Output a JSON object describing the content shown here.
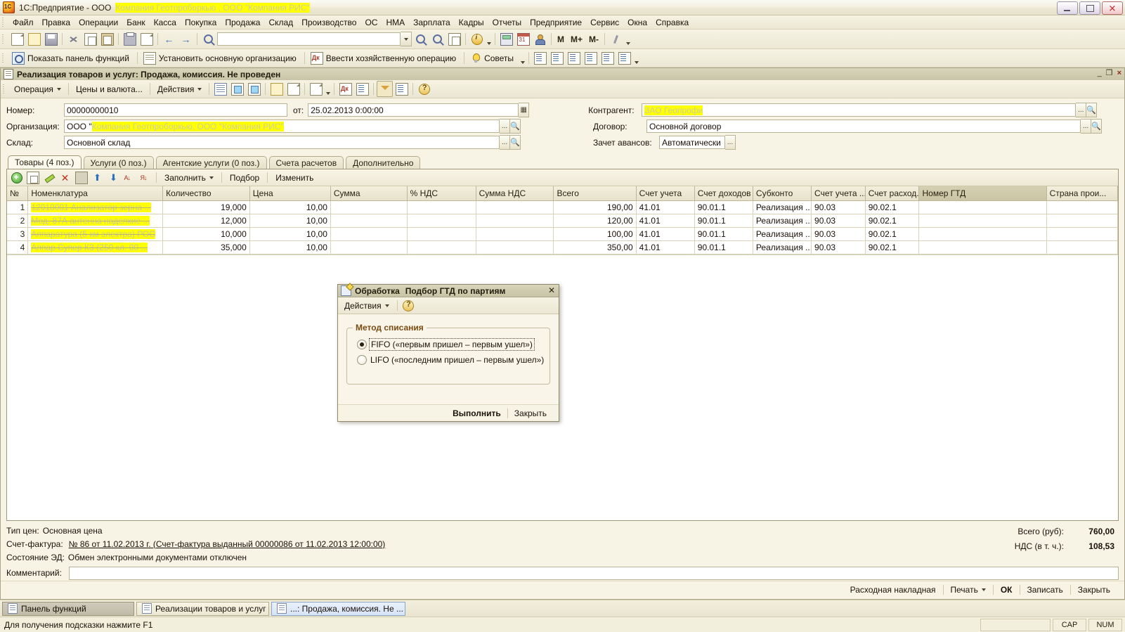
{
  "window": {
    "title_prefix": "1С:Предприятие - ООО",
    "title_redacted": "Компания Геотпроборкью , ООО \"Компания РИС\"",
    "minimize": "_",
    "restore": "❐",
    "close": "×"
  },
  "menubar": {
    "items": [
      "Файл",
      "Правка",
      "Операции",
      "Банк",
      "Касса",
      "Покупка",
      "Продажа",
      "Склад",
      "Производство",
      "ОС",
      "НМА",
      "Зарплата",
      "Кадры",
      "Отчеты",
      "Предприятие",
      "Сервис",
      "Окна",
      "Справка"
    ]
  },
  "toolbar_main": {
    "icons": [
      "new-document-icon",
      "open-document-icon",
      "save-icon",
      "cut-icon",
      "copy-icon",
      "paste-icon",
      "print-icon",
      "print-preview-icon",
      "undo-icon",
      "redo-icon",
      "find-icon"
    ],
    "search_value": "",
    "search_placeholder": "",
    "icons2": [
      "find-next-icon",
      "find-prev-icon",
      "copy-window-icon",
      "info-icon",
      "calculator-icon",
      "calendar-icon",
      "user-icon"
    ],
    "m_buttons": [
      "M",
      "M+",
      "M-"
    ],
    "settings_icon": "wrench-icon"
  },
  "toolbar_secondary": {
    "buttons": [
      {
        "label": "Показать панель функций",
        "icon": "functions-panel-icon"
      },
      {
        "label": "Установить основную организацию",
        "icon": "organization-icon"
      },
      {
        "label": "Ввести хозяйственную операцию",
        "icon": "dk-operation-icon"
      },
      {
        "label": "Советы",
        "icon": "lightbulb-icon"
      }
    ],
    "report_icons": [
      "report-turnover-icon",
      "report-balance-icon",
      "report-analysis-icon",
      "report-card-icon",
      "report-journal-icon",
      "report-chart-icon"
    ]
  },
  "document": {
    "title": "Реализация товаров и услуг: Продажа, комиссия. Не проведен",
    "win_minimize": "_",
    "win_restore": "❐",
    "win_close": "×",
    "toolbar": {
      "operation": "Операция",
      "prices": "Цены и валюта...",
      "actions": "Действия",
      "icons": [
        "post-and-close-icon",
        "post-icon",
        "post-new-icon",
        "fill-document-icon",
        "clear-icon",
        "based-on-icon",
        "dt-kt-icon",
        "register-report-icon",
        "filter-icon",
        "settings-list-icon",
        "help-icon"
      ]
    },
    "fields": {
      "number_label": "Номер:",
      "number_value": "00000000010",
      "date_label": "от:",
      "date_value": "25.02.2013  0:00:00",
      "organization_label": "Организация:",
      "organization_prefix": "ООО \"",
      "organization_redacted": "Компания Геотпроборкью, ООО \"Компания РИС\"",
      "warehouse_label": "Склад:",
      "warehouse_value": "Основной склад",
      "counterparty_label": "Контрагент:",
      "counterparty_redacted": "ЗАО Геопрофи",
      "contract_label": "Договор:",
      "contract_value": "Основной договор",
      "advances_label": "Зачет авансов:",
      "advances_value": "Автоматически"
    },
    "tabs": [
      {
        "label": "Товары (4 поз.)",
        "active": true
      },
      {
        "label": "Услуги (0 поз.)",
        "active": false
      },
      {
        "label": "Агентские услуги (0 поз.)",
        "active": false
      },
      {
        "label": "Счета расчетов",
        "active": false
      },
      {
        "label": "Дополнительно",
        "active": false
      }
    ],
    "grid_toolbar": {
      "icons": [
        "add-row-icon",
        "copy-row-icon",
        "edit-row-icon",
        "delete-row-icon",
        "set-period-icon",
        "move-up-icon",
        "move-down-icon",
        "sort-asc-icon",
        "sort-desc-icon"
      ],
      "fill": "Заполнить",
      "select": "Подбор",
      "change": "Изменить"
    },
    "table": {
      "columns": [
        "№",
        "Номенклатура",
        "Количество",
        "Цена",
        "Сумма",
        "% НДС",
        "Сумма НДС",
        "Всего",
        "Счет учета",
        "Счет доходов",
        "Субконто",
        "Счет учета ...",
        "Счет расход...",
        "Номер ГТД",
        "Страна прои..."
      ],
      "selected_column": "Номер ГТД",
      "rows": [
        {
          "n": "1",
          "nomenclature": "12010001 Анализатор зерна ...",
          "qty": "19,000",
          "price": "10,00",
          "sum": "",
          "vat_pct": "",
          "vat_sum": "",
          "total": "190,00",
          "acc": "41.01",
          "income_acc": "90.01.1",
          "subconto": "Реализация ...",
          "vat_acc": "90.03",
          "expense_acc": "90.02.1",
          "gtd": "",
          "country": ""
        },
        {
          "n": "2",
          "nomenclature": "Мод. 87А антенна наделкие ...",
          "qty": "12,000",
          "price": "10,00",
          "sum": "",
          "vat_pct": "",
          "vat_sum": "",
          "total": "120,00",
          "acc": "41.01",
          "income_acc": "90.01.1",
          "subconto": "Реализация ...",
          "vat_acc": "90.03",
          "expense_acc": "90.02.1",
          "gtd": "",
          "country": ""
        },
        {
          "n": "3",
          "nomenclature": "Аппаратура (5 км электра) РОС",
          "qty": "10,000",
          "price": "10,00",
          "sum": "",
          "vat_pct": "",
          "vat_sum": "",
          "total": "100,00",
          "acc": "41.01",
          "income_acc": "90.01.1",
          "subconto": "Реализация ...",
          "vat_acc": "90.03",
          "expense_acc": "90.02.1",
          "gtd": "",
          "country": ""
        },
        {
          "n": "4",
          "nomenclature": "Аппар Супер КЗ (250 кл. 00 ...",
          "qty": "35,000",
          "price": "10,00",
          "sum": "",
          "vat_pct": "",
          "vat_sum": "",
          "total": "350,00",
          "acc": "41.01",
          "income_acc": "90.01.1",
          "subconto": "Реализация ...",
          "vat_acc": "90.03",
          "expense_acc": "90.02.1",
          "gtd": "",
          "country": ""
        }
      ],
      "selected_cell_row": 2,
      "delete_marker": "✕"
    },
    "footer": {
      "price_type_label": "Тип цен:",
      "price_type_value": "Основная цена",
      "invoice_label": "Счет-фактура:",
      "invoice_link": "№ 86 от 11.02.2013 г. (Счет-фактура выданный 00000086 от 11.02.2013 12:00:00)",
      "ed_state_label": "Состояние ЭД:",
      "ed_state_value": "Обмен электронными документами отключен",
      "comment_label": "Комментарий:",
      "comment_value": "",
      "total_label": "Всего (руб):",
      "total_value": "760,00",
      "vat_label": "НДС (в т. ч.):",
      "vat_value": "108,53"
    },
    "buttons": [
      {
        "label": "Расходная накладная",
        "bold": false
      },
      {
        "label": "Печать",
        "bold": false,
        "dropdown": true
      },
      {
        "label": "ОК",
        "bold": true
      },
      {
        "label": "Записать",
        "bold": false
      },
      {
        "label": "Закрыть",
        "bold": false
      }
    ]
  },
  "modal": {
    "title_word1": "Обработка",
    "title_word2": "Подбор ГТД по партиям",
    "close": "✕",
    "actions_label": "Действия",
    "help_icon": "help-icon",
    "group_legend": "Метод списания",
    "options": [
      {
        "label": "FIFO («первым пришел – первым ушел»)",
        "selected": true,
        "focused": true
      },
      {
        "label": "LIFO («последним пришел – первым ушел»)",
        "selected": false,
        "focused": false
      }
    ],
    "execute": "Выполнить",
    "close_btn": "Закрыть"
  },
  "taskbar": {
    "items": [
      {
        "label": "Панель функций",
        "state": "active",
        "icon": "functions-panel-icon"
      },
      {
        "label": "Реализации товаров и услуг",
        "state": "normal",
        "icon": "document-list-icon"
      },
      {
        "label": "...: Продажа, комиссия. Не ...",
        "state": "selected",
        "icon": "document-icon"
      }
    ]
  },
  "statusbar": {
    "hint": "Для получения подсказки нажмите F1",
    "indicators": [
      "",
      "CAP",
      "NUM"
    ]
  },
  "colors": {
    "background": "#f2efdd",
    "redaction": "#ffff00",
    "selection": "#4a6bb5",
    "accent": "#7a4a10"
  }
}
